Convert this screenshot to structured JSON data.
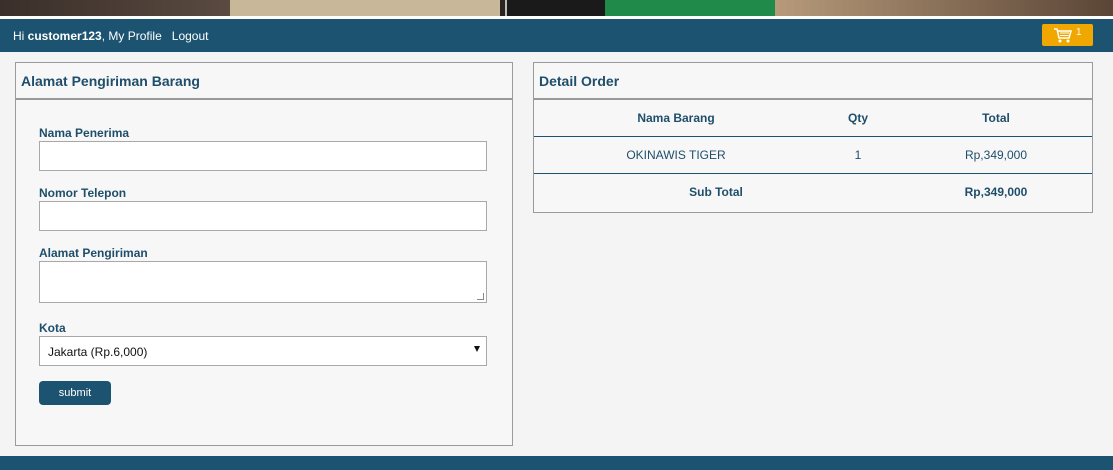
{
  "navbar": {
    "greeting_prefix": "Hi ",
    "username": "customer123",
    "comma": ",",
    "my_profile": "My Profile",
    "logout": "Logout",
    "cart_count": "1",
    "cart_icon": "shopping-cart-icon"
  },
  "shipping": {
    "title": "Alamat Pengiriman Barang",
    "name_label": "Nama Penerima",
    "name_value": "",
    "phone_label": "Nomor Telepon",
    "phone_value": "",
    "address_label": "Alamat Pengiriman",
    "address_value": "",
    "city_label": "Kota",
    "city_selected": "Jakarta (Rp.6,000)",
    "submit_label": "submit"
  },
  "order": {
    "title": "Detail Order",
    "columns": [
      "Nama Barang",
      "Qty",
      "Total"
    ],
    "items": [
      {
        "name": "OKINAWIS TIGER",
        "qty": "1",
        "total": "Rp,349,000"
      }
    ],
    "subtotal_label": "Sub Total",
    "subtotal_value": "Rp,349,000"
  },
  "colors": {
    "primary": "#1c5370",
    "cart": "#f0a800",
    "panel_bg": "#f7f7f7"
  }
}
